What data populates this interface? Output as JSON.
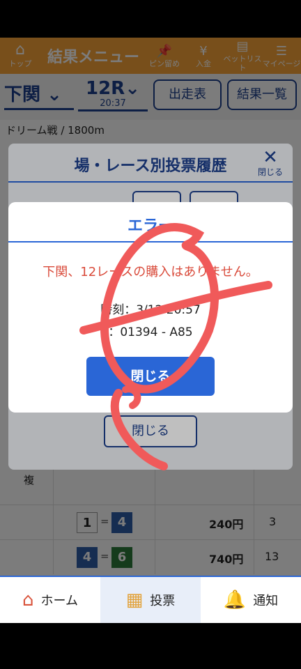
{
  "header": {
    "home_label": "トップ",
    "title": "結果メニュー",
    "items": [
      {
        "icon": "pin-icon",
        "label": "ピン留め"
      },
      {
        "icon": "deposit-icon",
        "label": "入金"
      },
      {
        "icon": "betlist-icon",
        "label": "ベットリスト"
      },
      {
        "icon": "menu-icon",
        "label": "マイページ"
      }
    ]
  },
  "race": {
    "venue": "下関",
    "race_no": "12R",
    "time": "20:37",
    "entry_button": "出走表",
    "results_button": "結果一覧",
    "info": "ドリーム戦 / 1800m"
  },
  "history_dialog": {
    "title": "場・レース別投票履歴",
    "close_label": "閉じる",
    "close_button": "閉じる"
  },
  "error_dialog": {
    "title": "エラー",
    "message": "下関、12レースの購入はありません。",
    "time_line": "時刻：3/12 20:57",
    "code_line": "：01394 - A85",
    "close_button": "閉じる"
  },
  "table": {
    "side_label": "複",
    "rows": [
      {
        "a": "1",
        "b": "4",
        "amount": "240円",
        "pop": "3"
      },
      {
        "a": "4",
        "b": "6",
        "amount": "740円",
        "pop": "13"
      }
    ]
  },
  "nav": {
    "items": [
      {
        "label": "ホーム",
        "icon": "home-icon"
      },
      {
        "label": "投票",
        "icon": "ticket-icon"
      },
      {
        "label": "通知",
        "icon": "bell-icon"
      }
    ]
  },
  "colors": {
    "header_orange": "#f6a33a",
    "primary_blue": "#2a66d6",
    "navy": "#1c3f8c",
    "error_red": "#d94a3a",
    "scribble_red": "#f05a5a"
  }
}
